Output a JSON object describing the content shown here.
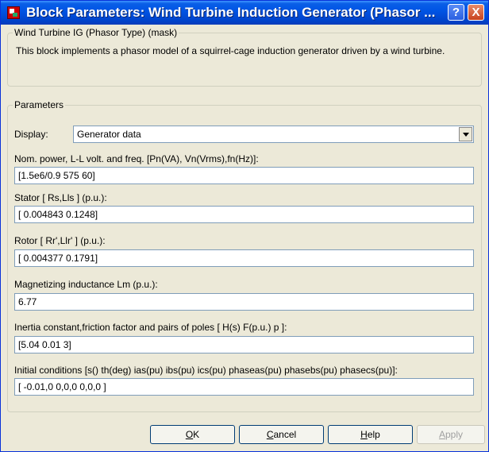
{
  "window": {
    "title": "Block Parameters: Wind Turbine Induction Generator (Phasor ..."
  },
  "titlebar": {
    "help_glyph": "?",
    "close_glyph": "X"
  },
  "mask": {
    "legend": "Wind Turbine IG (Phasor Type) (mask)",
    "description": "This block implements a phasor model of a squirrel-cage induction generator driven by a wind turbine."
  },
  "parameters": {
    "legend": "Parameters",
    "display_label": "Display:",
    "display_value": "Generator data",
    "fields": [
      {
        "label": "Nom. power, L-L volt. and freq. [Pn(VA), Vn(Vrms),fn(Hz)]:",
        "value": "[1.5e6/0.9 575 60]"
      },
      {
        "label": "Stator [ Rs,Lls ] (p.u.):",
        "value": "[ 0.004843 0.1248]"
      },
      {
        "label": "Rotor [ Rr',Llr' ] (p.u.):",
        "value": "[ 0.004377 0.1791]"
      },
      {
        "label": "Magnetizing inductance Lm (p.u.):",
        "value": "6.77"
      },
      {
        "label": "Inertia constant,friction factor and pairs of poles [ H(s)  F(p.u.)  p ]:",
        "value": "[5.04 0.01 3]"
      },
      {
        "label": "Initial conditions [s()  th(deg)  ias(pu)  ibs(pu)  ics(pu)  phaseas(pu) phasebs(pu) phasecs(pu)]:",
        "value": "[ -0.01,0   0,0,0   0,0,0 ]"
      }
    ]
  },
  "buttons": {
    "ok": {
      "label": "OK",
      "mnemonic": "O"
    },
    "cancel": {
      "label": "Cancel",
      "mnemonic": "C"
    },
    "help": {
      "label": "Help",
      "mnemonic": "H"
    },
    "apply": {
      "label": "Apply",
      "mnemonic": "A"
    }
  }
}
